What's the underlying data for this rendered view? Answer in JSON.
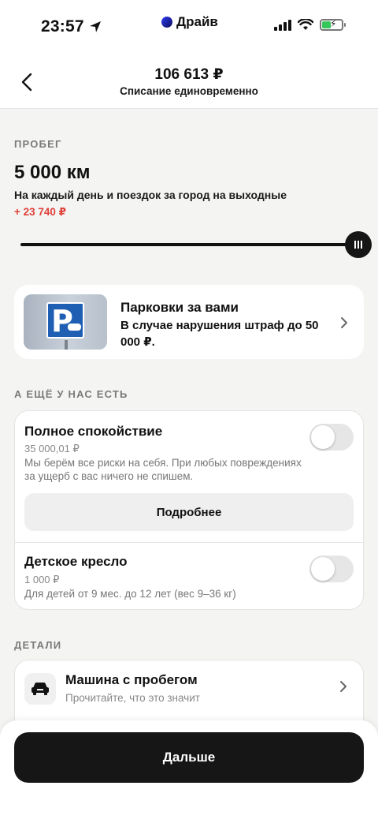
{
  "status_bar": {
    "time": "23:57",
    "app": "Драйв"
  },
  "header": {
    "price": "106 613 ₽",
    "subtitle": "Списание единовременно"
  },
  "mileage": {
    "label": "ПРОБЕГ",
    "value": "5 000 км",
    "description": "На каждый день и поездок за город на выходные",
    "extra_price": "+ 23 740 ₽",
    "slider_level": 1.0
  },
  "parking": {
    "title": "Парковки за вами",
    "text": "В случае нарушения штраф до 50 000 ₽."
  },
  "extras": {
    "label": "А ЕЩЁ У НАС ЕСТЬ",
    "options": [
      {
        "title": "Полное спокойствие",
        "price": "35 000,01 ₽",
        "description": "Мы берём все риски на себя. При любых повреждениях за ущерб с вас ничего не спишем.",
        "enabled": false,
        "more_label": "Подробнее"
      },
      {
        "title": "Детское кресло",
        "price": "1 000 ₽",
        "description": "Для детей от 9 мес. до 12 лет (вес 9–36 кг)",
        "enabled": false
      }
    ]
  },
  "details": {
    "label": "ДЕТАЛИ",
    "items": [
      {
        "title": "Машина с пробегом",
        "subtitle": "Прочитайте, что это значит",
        "icon": "car-icon"
      }
    ]
  },
  "footer": {
    "next_label": "Дальше"
  },
  "colors": {
    "accent_dark": "#161616",
    "price_red": "#e0403a",
    "battery_green": "#35c759"
  }
}
